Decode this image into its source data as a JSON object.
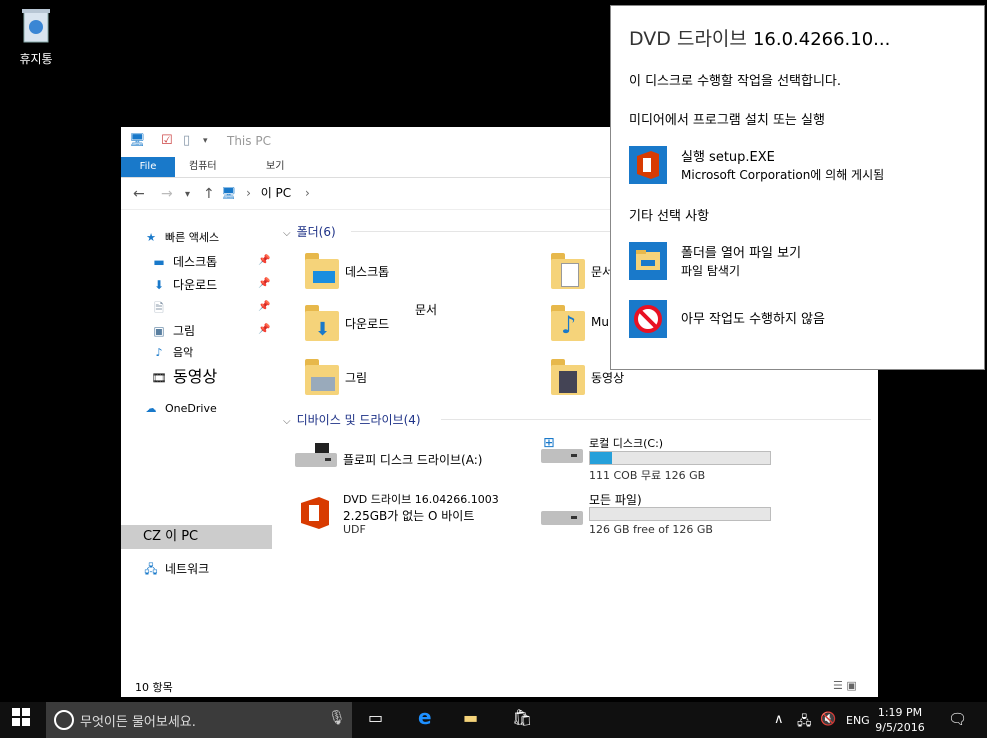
{
  "desktop": {
    "recycle_bin_label": "휴지통"
  },
  "explorer": {
    "title": "This PC",
    "ribbon_tabs": [
      "File",
      "컴퓨터",
      "보기"
    ],
    "address": [
      "이 PC"
    ],
    "sidebar": {
      "quick_access": "빠른 액세스",
      "desktop": "데스크톱",
      "downloads": "다운로드",
      "pictures": "그림",
      "music": "음악",
      "videos": "동영상",
      "onedrive": "OneDrive",
      "this_pc": "CZ 이 PC",
      "network": "네트워크"
    },
    "folders_header": "폴더(6)",
    "folders": {
      "desktop": "데스크톱",
      "documents": "문서",
      "downloads": "다운로드",
      "music": "Mu",
      "pictures": "그림",
      "videos": "동영상",
      "floating_label": "문서"
    },
    "devices_header": "디바이스 및 드라이브(4)",
    "drives": {
      "floppy": "플로피 디스크 드라이브(A:)",
      "local": {
        "name": "로컬 디스크(C:)",
        "detail": "111 COB 무료 126 GB",
        "used_fraction": 0.12
      },
      "dvd": {
        "name": "DVD 드라이브 16.04266.1003",
        "line2": "2.25GB가 없는 O 바이트",
        "line3": "UDF"
      },
      "other": {
        "name": "모든 파일)",
        "detail": "126 GB free of 126 GB",
        "used_fraction": 0.0
      }
    },
    "status": "10 항목"
  },
  "autoplay": {
    "title_prefix": "DVD 드라이브",
    "title_version": "16.0.4266.10...",
    "prompt": "이 디스크로 수행할 작업을 선택합니다.",
    "section_media": "미디어에서 프로그램 설치 또는 실행",
    "run_line1": "실행 setup.EXE",
    "run_line2": "Microsoft Corporation에 의해 게시됨",
    "section_other": "기타 선택 사항",
    "open_line1": "폴더를 열어 파일 보기",
    "open_line2": "파일 탐색기",
    "nothing": "아무 작업도 수행하지 않음"
  },
  "taskbar": {
    "search_placeholder": "무엇이든 물어보세요.",
    "language": "ENG",
    "time": "1:19 PM",
    "date": "9/5/2016"
  },
  "colors": {
    "accent": "#1979ca",
    "office_red": "#d83b01",
    "folder_yellow": "#f5d37a",
    "progress_blue": "#26a0da",
    "taskbar": "#101010"
  }
}
